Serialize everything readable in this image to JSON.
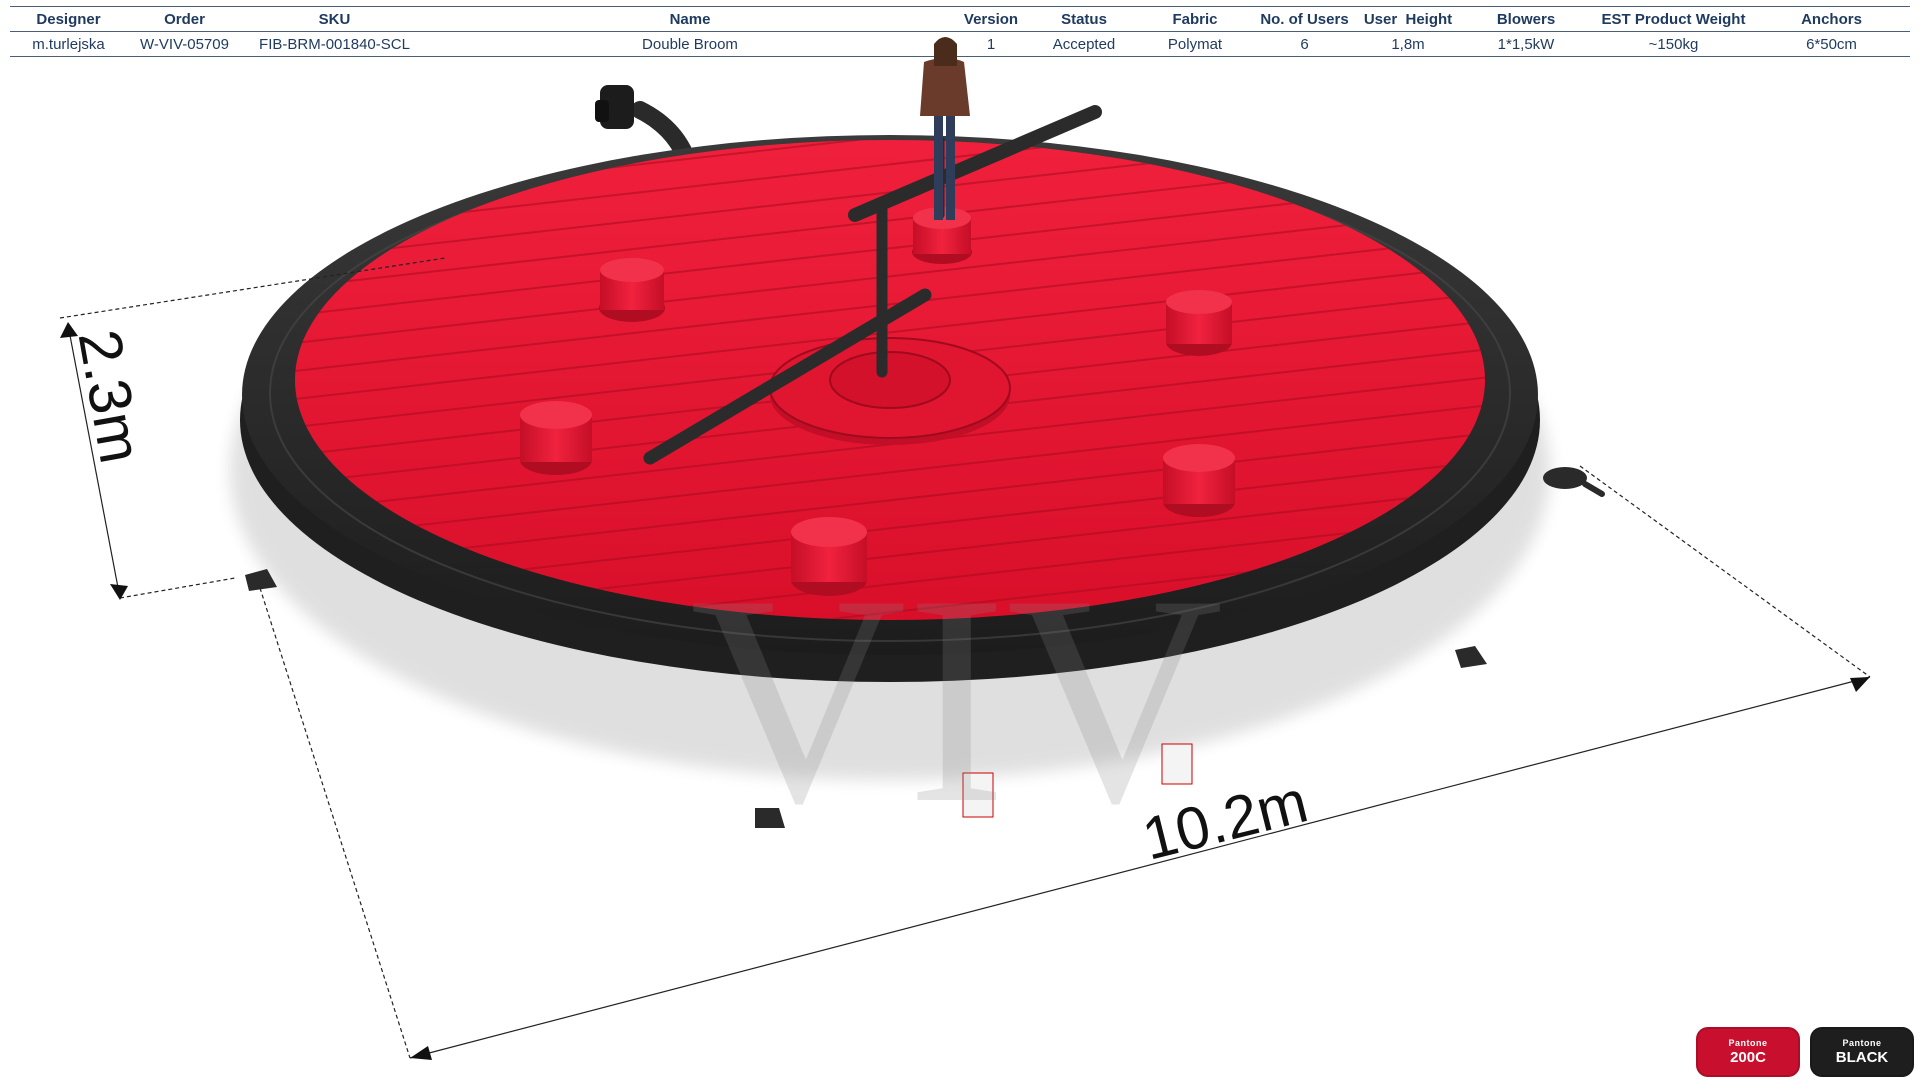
{
  "spec_table": {
    "headers": [
      "Designer",
      "Order",
      "SKU",
      "Name",
      "Version",
      "Status",
      "Fabric",
      "No. of Users",
      "User  Height",
      "Blowers",
      "EST Product Weight",
      "Anchors"
    ],
    "row": [
      "m.turlejska",
      "W-VIV-05709",
      "FIB-BRM-001840-SCL",
      "Double Broom",
      "1",
      "Accepted",
      "Polymat",
      "6",
      "1,8m",
      "1*1,5kW",
      "~150kg",
      "6*50cm"
    ]
  },
  "dimensions": {
    "height": "2.3m",
    "diameter": "10.2m"
  },
  "watermark_text": "VIV",
  "colors": {
    "mat_red": "#e3132f",
    "ring_black": "#2a2a2a",
    "header_text": "#1f3a5f",
    "pantone_red": "#c8102e",
    "pantone_black": "#1e1e1e"
  },
  "swatches": [
    {
      "line1": "Pantone",
      "line2": "200C"
    },
    {
      "line1": "Pantone",
      "line2": "BLACK"
    }
  ]
}
